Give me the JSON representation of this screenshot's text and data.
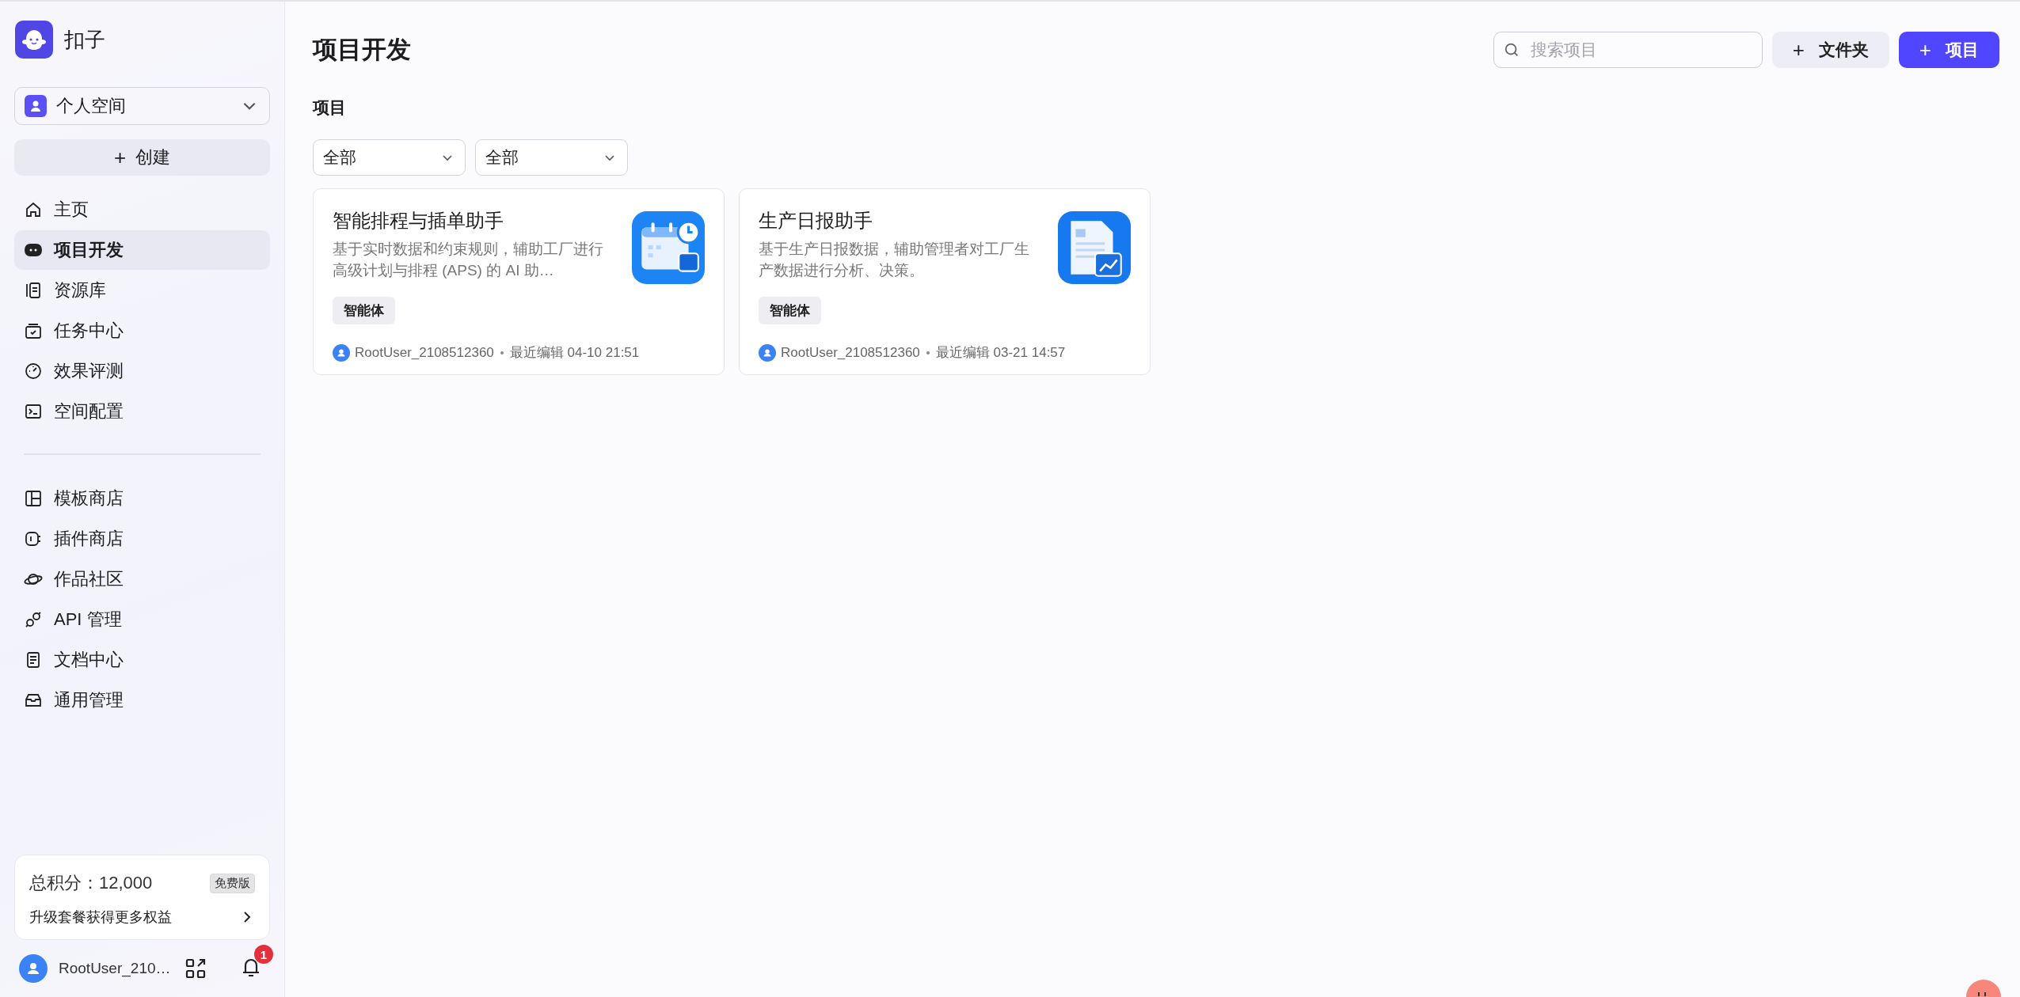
{
  "brand": {
    "name": "扣子"
  },
  "workspace": {
    "label": "个人空间"
  },
  "create_button": {
    "label": "创建",
    "icon": "+"
  },
  "nav_primary": [
    {
      "label": "主页",
      "selected": false
    },
    {
      "label": "项目开发",
      "selected": true
    },
    {
      "label": "资源库",
      "selected": false
    },
    {
      "label": "任务中心",
      "selected": false
    },
    {
      "label": "效果评测",
      "selected": false
    },
    {
      "label": "空间配置",
      "selected": false
    }
  ],
  "nav_secondary": [
    {
      "label": "模板商店",
      "selected": false
    },
    {
      "label": "插件商店",
      "selected": false
    },
    {
      "label": "作品社区",
      "selected": false
    },
    {
      "label": "API 管理",
      "selected": false
    },
    {
      "label": "文档中心",
      "selected": false
    },
    {
      "label": "通用管理",
      "selected": false
    }
  ],
  "points_card": {
    "total": "总积分：12,000",
    "plan": "免费版",
    "upgrade": "升级套餐获得更多权益"
  },
  "user": {
    "name": "RootUser_210…",
    "notifications": "1"
  },
  "page": {
    "title": "项目开发",
    "section": "项目"
  },
  "search": {
    "placeholder": "搜索项目"
  },
  "buttons": [
    {
      "label": "文件夹",
      "icon": "+",
      "kind": "secondary"
    },
    {
      "label": "项目",
      "icon": "+",
      "kind": "primary"
    }
  ],
  "filters": [
    {
      "value": "全部"
    },
    {
      "value": "全部"
    }
  ],
  "projects": [
    {
      "title": "智能排程与插单助手",
      "description": "基于实时数据和约束规则，辅助工厂进行高级计划与排程 (APS) 的 AI 助…",
      "tag": "智能体",
      "owner": "RootUser_2108512360",
      "edited": "最近编辑 04-10 21:51",
      "kind": "calendar"
    },
    {
      "title": "生产日报助手",
      "description": "基于生产日报数据，辅助管理者对工厂生产数据进行分析、决策。",
      "tag": "智能体",
      "owner": "RootUser_2108512360",
      "edited": "最近编辑 03-21 14:57",
      "kind": "report"
    }
  ]
}
